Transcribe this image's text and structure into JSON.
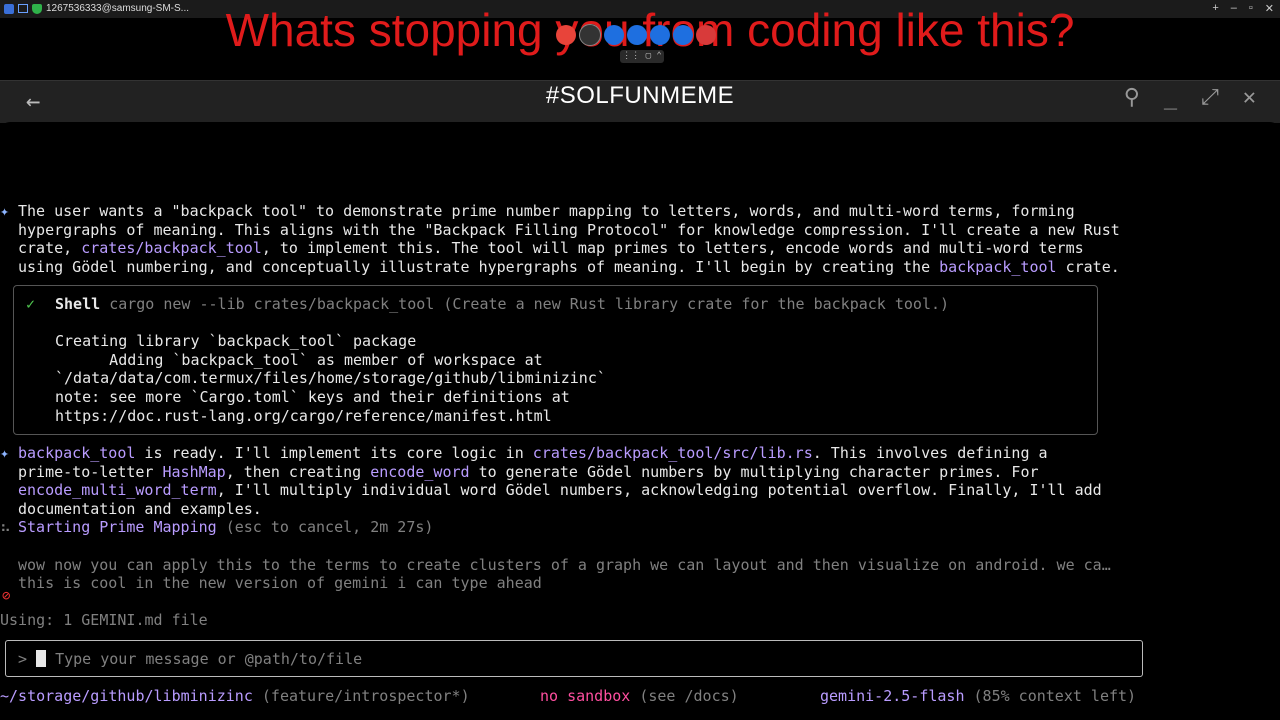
{
  "osbar": {
    "title": "1267536333@samsung-SM-S..."
  },
  "overlay": {
    "caption": "Whats stopping you from coding like this?"
  },
  "header": {
    "title": "#SOLFUNMEME"
  },
  "terminal": {
    "para1": [
      "The user wants a \"backpack tool\" to demonstrate prime number mapping to letters, words, and multi-word terms, forming",
      "hypergraphs of meaning. This aligns with the \"Backpack Filling Protocol\" for knowledge compression. I'll create a new Rust"
    ],
    "para1_l3_a": "crate, ",
    "para1_l3_link": "crates/backpack_tool",
    "para1_l3_b": ", to implement this. The tool will map primes to letters, encode words and multi-word terms",
    "para1_l4_a": "using Gödel numbering, and conceptually illustrate hypergraphs of meaning. I'll begin by creating the ",
    "para1_l4_link": "backpack_tool",
    "para1_l4_b": " crate.",
    "shell": {
      "check": "✓",
      "label": "Shell",
      "command": "cargo new --lib crates/backpack_tool (Create a new Rust library crate for the backpack tool.)",
      "output": [
        "Creating library `backpack_tool` package",
        "      Adding `backpack_tool` as member of workspace at",
        "`/data/data/com.termux/files/home/storage/github/libminizinc`",
        "note: see more `Cargo.toml` keys and their definitions at",
        "https://doc.rust-lang.org/cargo/reference/manifest.html"
      ]
    },
    "para2": {
      "l1_link1": "backpack_tool",
      "l1_a": " is ready. I'll implement its core logic in ",
      "l1_link2": "crates/backpack_tool/src/lib.rs",
      "l1_b": ". This involves defining a",
      "l2_a": "prime-to-letter ",
      "l2_link1": "HashMap",
      "l2_b": ", then creating ",
      "l2_link2": "encode_word",
      "l2_c": " to generate Gödel numbers by multiplying character primes. For",
      "l3_link": "encode_multi_word_term",
      "l3_a": ", I'll multiply individual word Gödel numbers, acknowledging potential overflow. Finally, I'll add",
      "l4": "documentation and examples."
    },
    "status": {
      "label": "Starting Prime Mapping",
      "hint": "(esc to cancel, 2m 27s)"
    },
    "queued": [
      "wow now you can apply this to the terms to create clusters of a graph we can layout and then visualize on android. we ca…",
      "this is cool in the new version of gemini i can type ahead"
    ],
    "using": "Using: 1 GEMINI.md file",
    "input": {
      "prompt": ">",
      "placeholder": "Type your message or @path/to/file"
    },
    "footer": {
      "path": "~/storage/github/libminizinc",
      "branch": "(feature/introspector*)",
      "sandbox": "no sandbox",
      "sandbox_hint": "(see /docs)",
      "model": "gemini-2.5-flash",
      "context": "(85% context left)"
    }
  }
}
